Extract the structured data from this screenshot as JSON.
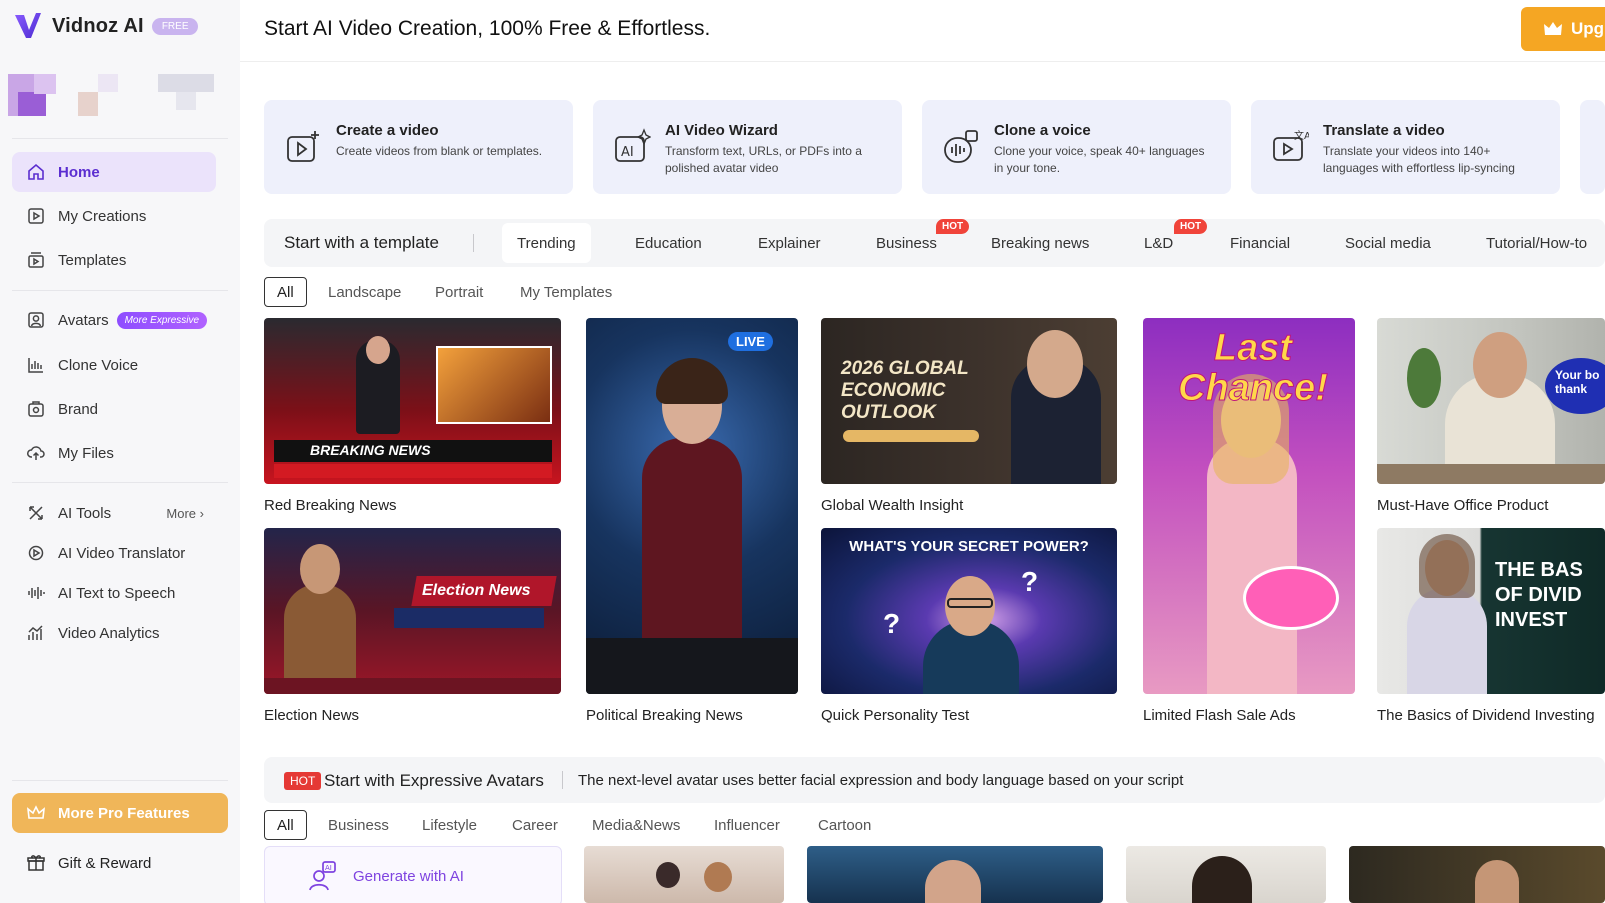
{
  "app": {
    "name": "Vidnoz AI",
    "badge": "FREE"
  },
  "headline": "Start AI Video Creation, 100% Free & Effortless.",
  "upgrade_label": "Upg",
  "sidebar": {
    "items": [
      {
        "label": "Home"
      },
      {
        "label": "My Creations"
      },
      {
        "label": "Templates"
      },
      {
        "label": "Avatars",
        "tag": "More Expressive"
      },
      {
        "label": "Clone Voice"
      },
      {
        "label": "Brand"
      },
      {
        "label": "My Files"
      },
      {
        "label": "AI Tools",
        "more": "More"
      },
      {
        "label": "AI Video Translator"
      },
      {
        "label": "AI Text to Speech"
      },
      {
        "label": "Video Analytics"
      }
    ],
    "pro_features": "More Pro Features",
    "gift": "Gift & Reward"
  },
  "features": [
    {
      "title": "Create a video",
      "desc": "Create videos from blank or templates."
    },
    {
      "title": "AI Video Wizard",
      "desc": "Transform text, URLs, or PDFs into a polished avatar video"
    },
    {
      "title": "Clone a voice",
      "desc": "Clone your voice, speak 40+ languages in your tone."
    },
    {
      "title": "Translate a video",
      "desc": "Translate your videos into 140+ languages with effortless lip-syncing"
    }
  ],
  "templates": {
    "title": "Start with a template",
    "tabs": [
      "Trending",
      "Education",
      "Explainer",
      "Business",
      "Breaking news",
      "L&D",
      "Financial",
      "Social media",
      "Tutorial/How-to"
    ],
    "hot_label": "HOT",
    "filters": [
      "All",
      "Landscape",
      "Portrait",
      "My Templates"
    ],
    "items": [
      {
        "caption": "Red Breaking News",
        "overlay": "BREAKING NEWS",
        "color": "#b3141d"
      },
      {
        "caption": "Political Breaking News",
        "overlay": "LIVE",
        "color": "#1d3c6e"
      },
      {
        "caption": "Global Wealth Insight",
        "overlay": "2026 GLOBAL ECONOMIC OUTLOOK",
        "color": "#2b2420"
      },
      {
        "caption": "Limited Flash Sale Ads",
        "overlay": "Last Chance!",
        "color": "#b23cc4"
      },
      {
        "caption": "Must-Have Office Product",
        "overlay": "Your bo thank",
        "color": "#c7c9c4"
      },
      {
        "caption": "Election News",
        "overlay": "Election News",
        "color": "#7a1420"
      },
      {
        "caption": "Quick Personality Test",
        "overlay": "WHAT'S YOUR SECRET POWER?",
        "color": "#1a2f6a"
      },
      {
        "caption": "The Basics of Dividend Investing",
        "overlay": "THE BAS OF DIVID INVEST",
        "color": "#173532"
      }
    ]
  },
  "avatars": {
    "hot": "HOT",
    "title": "Start with Expressive Avatars",
    "desc": "The next-level avatar uses better facial expression and body language based on your script",
    "filters": [
      "All",
      "Business",
      "Lifestyle",
      "Career",
      "Media&News",
      "Influencer",
      "Cartoon"
    ],
    "generate": "Generate with AI"
  }
}
